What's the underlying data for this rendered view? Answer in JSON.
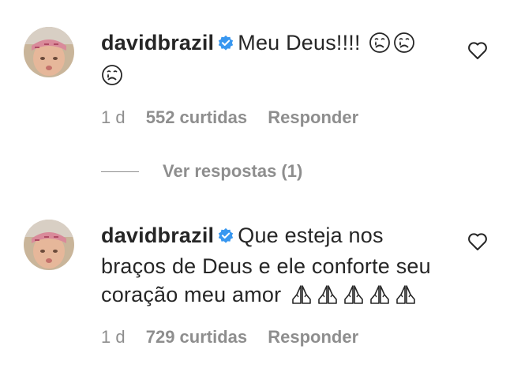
{
  "comments": [
    {
      "username": "davidbrazil",
      "text": "Meu Deus!!!!",
      "emojis_inline": [
        "crying-face",
        "crying-face"
      ],
      "emojis_wrap": [
        "crying-face"
      ],
      "time": "1 d",
      "likes": "552 curtidas",
      "reply_label": "Responder"
    },
    {
      "username": "davidbrazil",
      "text_line1": "Que esteja nos",
      "text_line2": "braços de Deus e ele conforte seu",
      "text_line3": "coração meu amor",
      "emojis_line3": [
        "folded-hands",
        "folded-hands",
        "folded-hands",
        "folded-hands",
        "folded-hands"
      ],
      "time": "1 d",
      "likes": "729 curtidas",
      "reply_label": "Responder"
    }
  ],
  "view_replies": "Ver respostas (1)",
  "colors": {
    "text": "#262626",
    "muted": "#8e8e8e",
    "verified": "#3897f0"
  }
}
